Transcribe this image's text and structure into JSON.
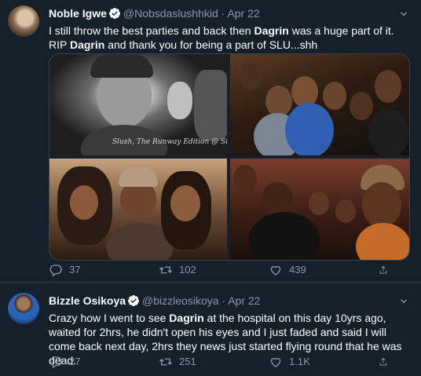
{
  "tweets": [
    {
      "author_name": "Noble Igwe",
      "handle": "@Nobsdaslushhkid",
      "separator": "·",
      "date": "Apr 22",
      "text_parts": [
        {
          "t": "I still throw the best parties and back then ",
          "b": false
        },
        {
          "t": "Dagrin",
          "b": true
        },
        {
          "t": " was a huge part of it. RIP ",
          "b": false
        },
        {
          "t": "Dagrin",
          "b": true
        },
        {
          "t": " and thank you for being a part of SLU...shh",
          "b": false
        }
      ],
      "photo_caption": "Slush, The Runway Edition @ Sive Bar",
      "replies": "37",
      "retweets": "102",
      "likes": "439"
    },
    {
      "author_name": "Bizzle Osikoya",
      "handle": "@bizzleosikoya",
      "separator": "·",
      "date": "Apr 22",
      "text_parts": [
        {
          "t": "Crazy how I went to see ",
          "b": false
        },
        {
          "t": "Dagrin",
          "b": true
        },
        {
          "t": " at the hospital on this day 10yrs ago, waited for 2hrs, he didn't open his eyes and I just faded and said I will come back next day, 2hrs they news just started flying round that he was dead.",
          "b": false
        }
      ],
      "replies": "27",
      "retweets": "251",
      "likes": "1.1K"
    }
  ],
  "colors": {
    "background": "#15202b",
    "muted": "#8899a6",
    "verified": "#1da1f2",
    "border": "#38444d"
  },
  "icons": [
    "verified-badge-icon",
    "chevron-down-icon",
    "reply-icon",
    "retweet-icon",
    "like-icon",
    "share-icon"
  ]
}
